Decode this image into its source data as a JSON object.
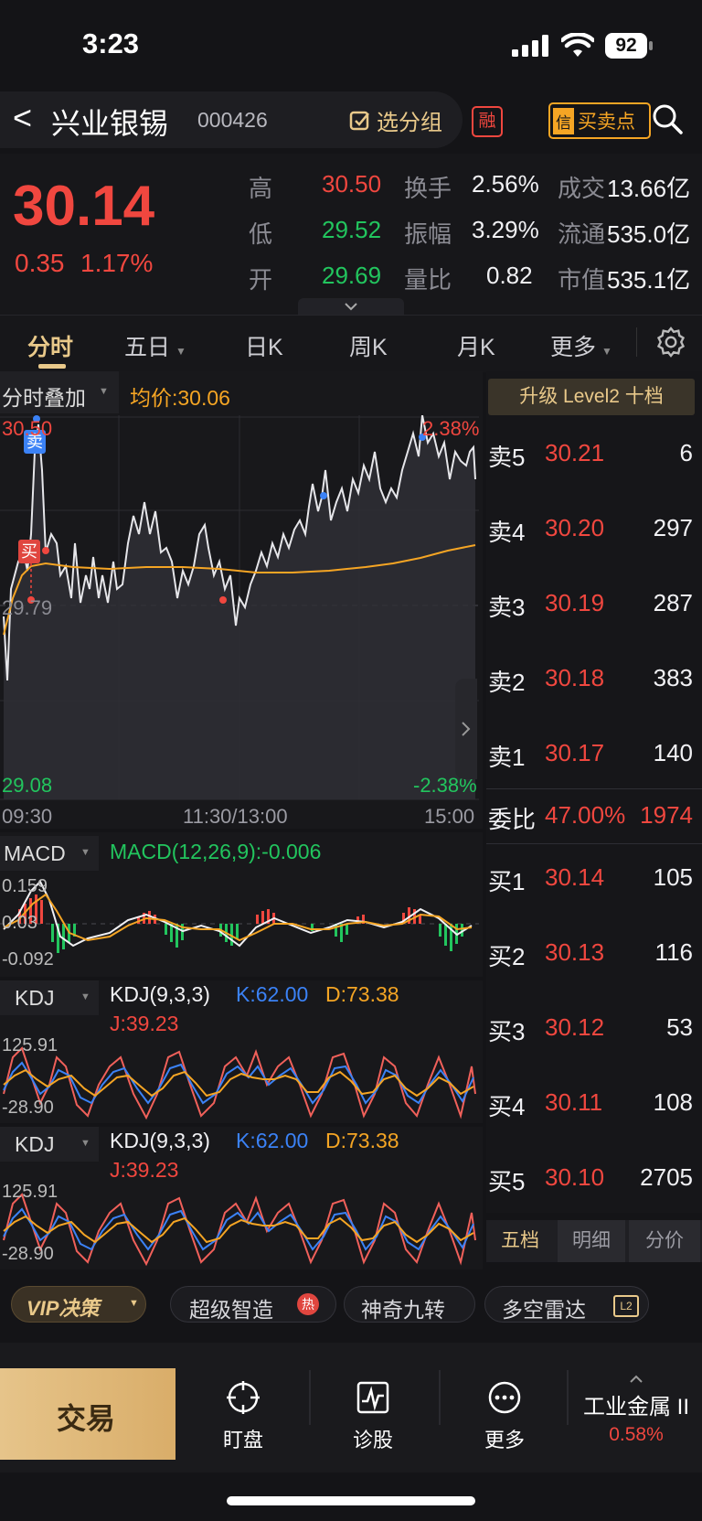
{
  "status_bar": {
    "time": "3:23",
    "battery": "92"
  },
  "header": {
    "back": "<",
    "name": "兴业银锡",
    "code": "000426",
    "group_btn": "选分组",
    "margin_badge": "融",
    "trade_points_badge": "信",
    "trade_points_label": "买卖点"
  },
  "quote": {
    "price": "30.14",
    "change": "0.35",
    "change_pct": "1.17%",
    "stats": [
      {
        "l1": "高",
        "v1": "30.50",
        "l2": "换手",
        "v2": "2.56%",
        "l3": "成交",
        "v3": "13.66亿"
      },
      {
        "l1": "低",
        "v1": "29.52",
        "l2": "振幅",
        "v2": "3.29%",
        "l3": "流通",
        "v3": "535.0亿"
      },
      {
        "l1": "开",
        "v1": "29.69",
        "l2": "量比",
        "v2": "0.82",
        "l3": "市值",
        "v3": "535.1亿"
      }
    ]
  },
  "tabs": [
    "分时",
    "五日",
    "日K",
    "周K",
    "月K",
    "更多"
  ],
  "intraday": {
    "overlay_label": "分时叠加",
    "avg_label": "均价:",
    "avg_value": "30.06",
    "high": "30.50",
    "high_pct": "2.38%",
    "mid": "29.79",
    "low": "29.08",
    "low_pct": "-2.38%",
    "times": [
      "09:30",
      "11:30/13:00",
      "15:00"
    ],
    "sell_marker": "卖",
    "buy_marker": "买"
  },
  "level2_btn": "升级 Level2 十档",
  "order_book": {
    "asks": [
      {
        "label": "卖5",
        "price": "30.21",
        "vol": "6"
      },
      {
        "label": "卖4",
        "price": "30.20",
        "vol": "297"
      },
      {
        "label": "卖3",
        "price": "30.19",
        "vol": "287"
      },
      {
        "label": "卖2",
        "price": "30.18",
        "vol": "383"
      },
      {
        "label": "卖1",
        "price": "30.17",
        "vol": "140"
      }
    ],
    "ratio": {
      "label": "委比",
      "pct": "47.00%",
      "vol": "1974"
    },
    "bids": [
      {
        "label": "买1",
        "price": "30.14",
        "vol": "105"
      },
      {
        "label": "买2",
        "price": "30.13",
        "vol": "116"
      },
      {
        "label": "买3",
        "price": "30.12",
        "vol": "53"
      },
      {
        "label": "买4",
        "price": "30.11",
        "vol": "108"
      },
      {
        "label": "买5",
        "price": "30.10",
        "vol": "2705"
      }
    ],
    "tabs": [
      "五档",
      "明细",
      "分价"
    ]
  },
  "macd": {
    "label": "MACD",
    "formula": "MACD(12,26,9):-0.006",
    "top": "0.159",
    "mid": "0.03",
    "bottom": "-0.092"
  },
  "kdj1": {
    "label": "KDJ",
    "params": "KDJ(9,3,3)",
    "k": "K:62.00",
    "d": "D:73.38",
    "j": "J:39.23",
    "top": "125.91",
    "bottom": "-28.90"
  },
  "kdj2": {
    "label": "KDJ",
    "params": "KDJ(9,3,3)",
    "k": "K:62.00",
    "d": "D:73.38",
    "j": "J:39.23",
    "top": "125.91",
    "bottom": "-28.90"
  },
  "chips": {
    "vip": "VIP决策",
    "c1": "超级智造",
    "hot": "热",
    "c2": "神奇九转",
    "c3": "多空雷达"
  },
  "bottom": {
    "trade": "交易",
    "watch": "盯盘",
    "diag": "诊股",
    "more": "更多",
    "sector": "工业金属 II",
    "sector_pct": "0.58%"
  },
  "colors": {
    "up": "#f0473f",
    "down": "#22c55e",
    "avg": "#f5a524",
    "accent_gold": "#e9c98a"
  }
}
